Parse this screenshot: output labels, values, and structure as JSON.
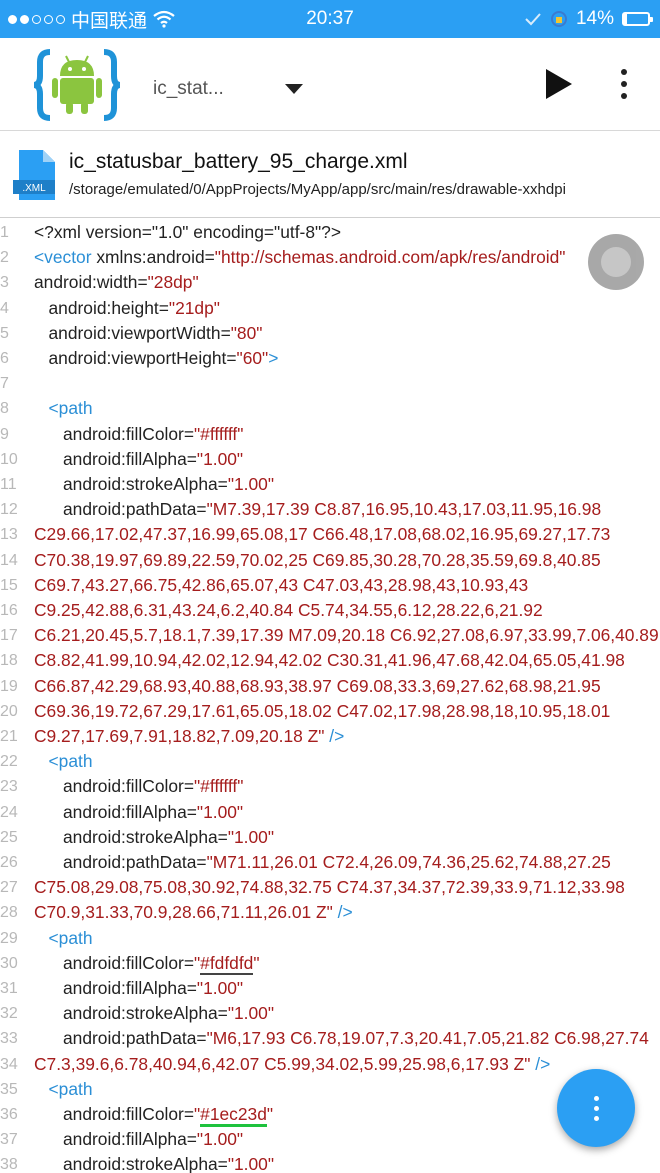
{
  "status_bar": {
    "carrier": "中国联通",
    "time": "20:37",
    "battery_percent": "14%",
    "battery_level": 0.14
  },
  "toolbar": {
    "selected_file": "ic_stat...",
    "run_icon": "play-icon",
    "menu_icon": "more-vert-icon"
  },
  "file": {
    "name": "ic_statusbar_battery_95_charge.xml",
    "path": "/storage/emulated/0/AppProjects/MyApp/app/src/main/res/drawable-xxhdpi",
    "icon_label": ".XML"
  },
  "colors": {
    "accent": "#2b9ff3",
    "tag": "#2b8fd6",
    "string": "#a51d1d",
    "line_number": "#b8b8b8",
    "green_underline": "#1ec23d"
  },
  "code_lines": [
    {
      "n": "1",
      "tokens": [
        [
          "plain",
          "<?xml version=\"1.0\" encoding=\"utf-8\"?>"
        ]
      ]
    },
    {
      "n": "2",
      "tokens": [
        [
          "tag",
          "<vector "
        ],
        [
          "attr",
          "xmlns:android"
        ],
        [
          "eq",
          "="
        ],
        [
          "str",
          "\"http://schemas.android.com/apk/res/android\""
        ]
      ]
    },
    {
      "n": "3",
      "tokens": [
        [
          "attr",
          "android:width"
        ],
        [
          "eq",
          "="
        ],
        [
          "str",
          "\"28dp\""
        ]
      ]
    },
    {
      "n": "4",
      "tokens": [
        [
          "attr",
          "   android:height"
        ],
        [
          "eq",
          "="
        ],
        [
          "str",
          "\"21dp\""
        ]
      ]
    },
    {
      "n": "5",
      "tokens": [
        [
          "attr",
          "   android:viewportWidth"
        ],
        [
          "eq",
          "="
        ],
        [
          "str",
          "\"80\""
        ]
      ]
    },
    {
      "n": "6",
      "tokens": [
        [
          "attr",
          "   android:viewportHeight"
        ],
        [
          "eq",
          "="
        ],
        [
          "str",
          "\"60\""
        ],
        [
          "tag",
          ">"
        ]
      ]
    },
    {
      "n": "7",
      "tokens": []
    },
    {
      "n": "8",
      "tokens": [
        [
          "tag",
          "   <path"
        ]
      ]
    },
    {
      "n": "9",
      "tokens": [
        [
          "attr",
          "      android:fillColor"
        ],
        [
          "eq",
          "="
        ],
        [
          "str",
          "\"#ffffff\""
        ]
      ]
    },
    {
      "n": "10",
      "tokens": [
        [
          "attr",
          "      android:fillAlpha"
        ],
        [
          "eq",
          "="
        ],
        [
          "str",
          "\"1.00\""
        ]
      ]
    },
    {
      "n": "11",
      "tokens": [
        [
          "attr",
          "      android:strokeAlpha"
        ],
        [
          "eq",
          "="
        ],
        [
          "str",
          "\"1.00\""
        ]
      ]
    },
    {
      "n": "12",
      "tokens": [
        [
          "attr",
          "      android:pathData"
        ],
        [
          "eq",
          "="
        ],
        [
          "str",
          "\"M7.39,17.39 C8.87,16.95,10.43,17.03,11.95,16.98"
        ]
      ]
    },
    {
      "n": "13",
      "tokens": [
        [
          "red",
          "C29.66,17.02,47.37,16.99,65.08,17 C66.48,17.08,68.02,16.95,69.27,17.73"
        ]
      ]
    },
    {
      "n": "14",
      "tokens": [
        [
          "red",
          "C70.38,19.97,69.89,22.59,70.02,25 C69.85,30.28,70.28,35.59,69.8,40.85"
        ]
      ]
    },
    {
      "n": "15",
      "tokens": [
        [
          "red",
          "C69.7,43.27,66.75,42.86,65.07,43 C47.03,43,28.98,43,10.93,43"
        ]
      ]
    },
    {
      "n": "16",
      "tokens": [
        [
          "red",
          "C9.25,42.88,6.31,43.24,6.2,40.84 C5.74,34.55,6.12,28.22,6,21.92"
        ]
      ]
    },
    {
      "n": "17",
      "tokens": [
        [
          "red",
          "C6.21,20.45,5.7,18.1,7.39,17.39 M7.09,20.18 C6.92,27.08,6.97,33.99,7.06,40.89"
        ]
      ]
    },
    {
      "n": "18",
      "tokens": [
        [
          "red",
          "C8.82,41.99,10.94,42.02,12.94,42.02 C30.31,41.96,47.68,42.04,65.05,41.98"
        ]
      ]
    },
    {
      "n": "19",
      "tokens": [
        [
          "red",
          "C66.87,42.29,68.93,40.88,68.93,38.97 C69.08,33.3,69,27.62,68.98,21.95"
        ]
      ]
    },
    {
      "n": "20",
      "tokens": [
        [
          "red",
          "C69.36,19.72,67.29,17.61,65.05,18.02 C47.02,17.98,28.98,18,10.95,18.01"
        ]
      ]
    },
    {
      "n": "21",
      "tokens": [
        [
          "red",
          "C9.27,17.69,7.91,18.82,7.09,20.18 Z\""
        ],
        [
          "tag",
          " />"
        ]
      ]
    },
    {
      "n": "22",
      "tokens": [
        [
          "tag",
          "   <path"
        ]
      ]
    },
    {
      "n": "23",
      "tokens": [
        [
          "attr",
          "      android:fillColor"
        ],
        [
          "eq",
          "="
        ],
        [
          "str",
          "\"#ffffff\""
        ]
      ]
    },
    {
      "n": "24",
      "tokens": [
        [
          "attr",
          "      android:fillAlpha"
        ],
        [
          "eq",
          "="
        ],
        [
          "str",
          "\"1.00\""
        ]
      ]
    },
    {
      "n": "25",
      "tokens": [
        [
          "attr",
          "      android:strokeAlpha"
        ],
        [
          "eq",
          "="
        ],
        [
          "str",
          "\"1.00\""
        ]
      ]
    },
    {
      "n": "26",
      "tokens": [
        [
          "attr",
          "      android:pathData"
        ],
        [
          "eq",
          "="
        ],
        [
          "str",
          "\"M71.11,26.01 C72.4,26.09,74.36,25.62,74.88,27.25"
        ]
      ]
    },
    {
      "n": "27",
      "tokens": [
        [
          "red",
          "C75.08,29.08,75.08,30.92,74.88,32.75 C74.37,34.37,72.39,33.9,71.12,33.98"
        ]
      ]
    },
    {
      "n": "28",
      "tokens": [
        [
          "red",
          "C70.9,31.33,70.9,28.66,71.11,26.01 Z\""
        ],
        [
          "tag",
          " />"
        ]
      ]
    },
    {
      "n": "29",
      "tokens": [
        [
          "tag",
          "   <path"
        ]
      ]
    },
    {
      "n": "30",
      "tokens": [
        [
          "attr",
          "      android:fillColor"
        ],
        [
          "eq",
          "="
        ],
        [
          "str",
          "\""
        ],
        [
          "uline-dark",
          "#fdfdfd"
        ],
        [
          "str",
          "\""
        ]
      ]
    },
    {
      "n": "31",
      "tokens": [
        [
          "attr",
          "      android:fillAlpha"
        ],
        [
          "eq",
          "="
        ],
        [
          "str",
          "\"1.00\""
        ]
      ]
    },
    {
      "n": "32",
      "tokens": [
        [
          "attr",
          "      android:strokeAlpha"
        ],
        [
          "eq",
          "="
        ],
        [
          "str",
          "\"1.00\""
        ]
      ]
    },
    {
      "n": "33",
      "tokens": [
        [
          "attr",
          "      android:pathData"
        ],
        [
          "eq",
          "="
        ],
        [
          "str",
          "\"M6,17.93 C6.78,19.07,7.3,20.41,7.05,21.82 C6.98,27.74"
        ]
      ]
    },
    {
      "n": "34",
      "tokens": [
        [
          "red",
          "C7.3,39.6,6.78,40.94,6,42.07 C5.99,34.02,5.99,25.98,6,17.93 Z\""
        ],
        [
          "tag",
          " />"
        ]
      ]
    },
    {
      "n": "35",
      "tokens": [
        [
          "tag",
          "   <path"
        ]
      ]
    },
    {
      "n": "36",
      "tokens": [
        [
          "attr",
          "      android:fillColor"
        ],
        [
          "eq",
          "="
        ],
        [
          "str",
          "\""
        ],
        [
          "uline-green",
          "#1ec23d"
        ],
        [
          "str",
          "\""
        ]
      ]
    },
    {
      "n": "37",
      "tokens": [
        [
          "attr",
          "      android:fillAlpha"
        ],
        [
          "eq",
          "="
        ],
        [
          "str",
          "\"1.00\""
        ]
      ]
    },
    {
      "n": "38",
      "tokens": [
        [
          "attr",
          "      android:strokeAlpha"
        ],
        [
          "eq",
          "="
        ],
        [
          "str",
          "\"1.00\""
        ]
      ]
    }
  ]
}
